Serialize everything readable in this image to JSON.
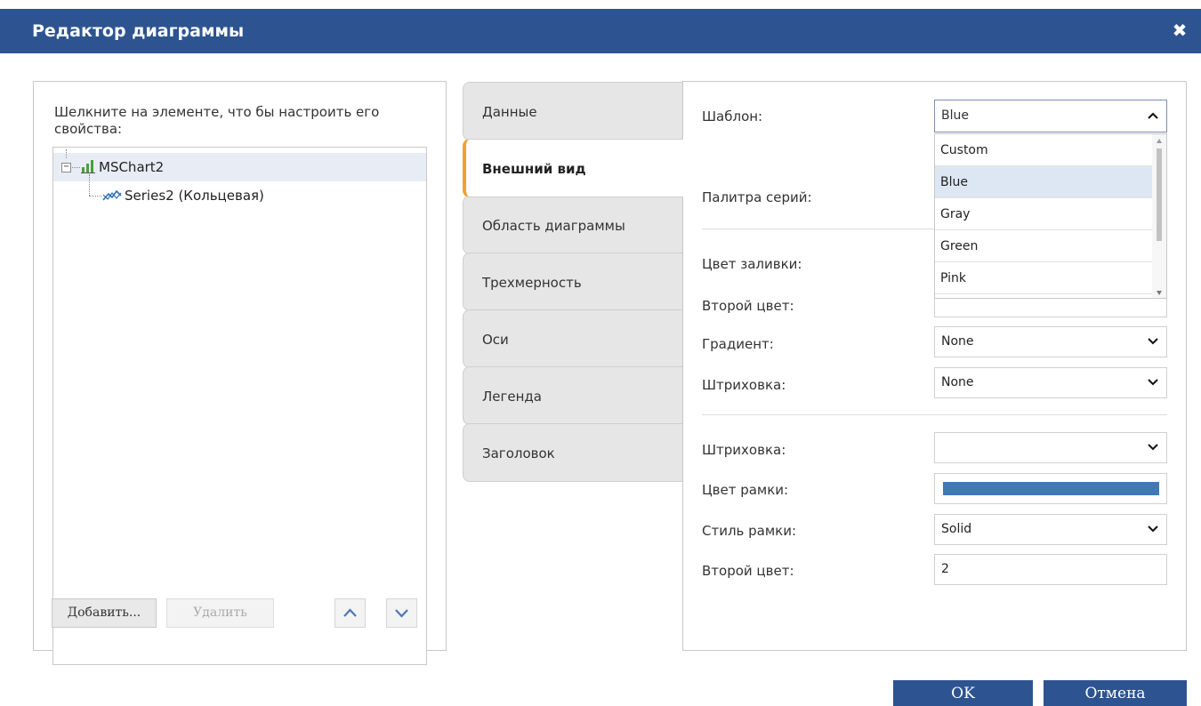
{
  "dialog": {
    "title": "Редактор диаграммы"
  },
  "left": {
    "hint": "Шелкните на элементе, что бы настроить его свойства:",
    "tree": [
      {
        "label": "MSChart2",
        "icon": "bar-chart-icon"
      },
      {
        "label": "Series2 (Кольцевая)",
        "icon": "line-series-icon"
      }
    ],
    "add_label": "Добавить...",
    "delete_label": "Удалить"
  },
  "tabs": [
    {
      "label": "Данные"
    },
    {
      "label": "Внешний вид"
    },
    {
      "label": "Область диаграммы"
    },
    {
      "label": "Трехмерность"
    },
    {
      "label": "Оси"
    },
    {
      "label": "Легенда"
    },
    {
      "label": "Заголовок"
    }
  ],
  "props": {
    "template_label": "Шаблон:",
    "template_value": "Blue",
    "template_options": [
      "Custom",
      "Blue",
      "Gray",
      "Green",
      "Pink"
    ],
    "palette_label": "Палитра серий:",
    "fill_color_label": "Цвет заливки:",
    "second_color_label": "Второй цвет:",
    "gradient_label": "Градиент:",
    "gradient_value": "None",
    "hatch_label": "Штриховка:",
    "hatch_value": "None",
    "hatch2_label": "Штриховка:",
    "hatch2_value": "",
    "border_color_label": "Цвет рамки:",
    "border_color": "#3f7ab3",
    "border_style_label": "Стиль рамки:",
    "border_style_value": "Solid",
    "second_color2_label": "Второй цвет:",
    "second_color2_value": "2"
  },
  "footer": {
    "ok_label": "OK",
    "cancel_label": "Отмена"
  },
  "colors": {
    "titlebar": "#2d5490",
    "active_tab_accent": "#f0a030",
    "button": "#2d5490"
  }
}
